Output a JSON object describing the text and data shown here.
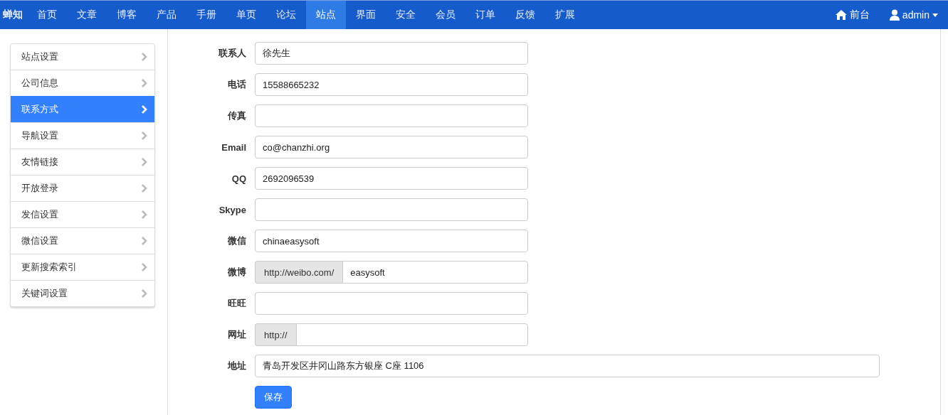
{
  "brand": "蝉知",
  "nav": [
    {
      "label": "首页",
      "selected": false
    },
    {
      "label": "文章",
      "selected": false
    },
    {
      "label": "博客",
      "selected": false
    },
    {
      "label": "产品",
      "selected": false
    },
    {
      "label": "手册",
      "selected": false
    },
    {
      "label": "单页",
      "selected": false
    },
    {
      "label": "论坛",
      "selected": false
    },
    {
      "label": "站点",
      "selected": true
    },
    {
      "label": "界面",
      "selected": false
    },
    {
      "label": "安全",
      "selected": false
    },
    {
      "label": "会员",
      "selected": false
    },
    {
      "label": "订单",
      "selected": false
    },
    {
      "label": "反馈",
      "selected": false
    },
    {
      "label": "扩展",
      "selected": false
    }
  ],
  "nav_right": [
    {
      "kind": "home",
      "label": "前台"
    },
    {
      "kind": "user",
      "label": "admin"
    }
  ],
  "sidebar": [
    {
      "label": "站点设置",
      "selected": false
    },
    {
      "label": "公司信息",
      "selected": false
    },
    {
      "label": "联系方式",
      "selected": true
    },
    {
      "label": "导航设置",
      "selected": false
    },
    {
      "label": "友情链接",
      "selected": false
    },
    {
      "label": "开放登录",
      "selected": false
    },
    {
      "label": "发信设置",
      "selected": false
    },
    {
      "label": "微信设置",
      "selected": false
    },
    {
      "label": "更新搜索索引",
      "selected": false
    },
    {
      "label": "关键词设置",
      "selected": false
    }
  ],
  "form": [
    {
      "label": "联系人",
      "kind": "text",
      "value": "徐先生"
    },
    {
      "label": "电话",
      "kind": "text",
      "value": "15588665232"
    },
    {
      "label": "传真",
      "kind": "text"
    },
    {
      "label": "Email",
      "kind": "text",
      "value": "co@chanzhi.org"
    },
    {
      "label": "QQ",
      "kind": "text",
      "value": "2692096539"
    },
    {
      "label": "Skype",
      "kind": "text"
    },
    {
      "label": "微信",
      "kind": "text",
      "value": "chinaeasysoft"
    },
    {
      "label": "微博",
      "kind": "prefixed",
      "prefix": "http://weibo.com/",
      "value": "easysoft"
    },
    {
      "label": "旺旺",
      "kind": "text"
    },
    {
      "label": "网址",
      "kind": "prefixed",
      "prefix": "http://"
    },
    {
      "label": "地址",
      "kind": "wide",
      "value": "青岛开发区井冈山路东方银座 C座 1106"
    }
  ],
  "save_button": "保存"
}
